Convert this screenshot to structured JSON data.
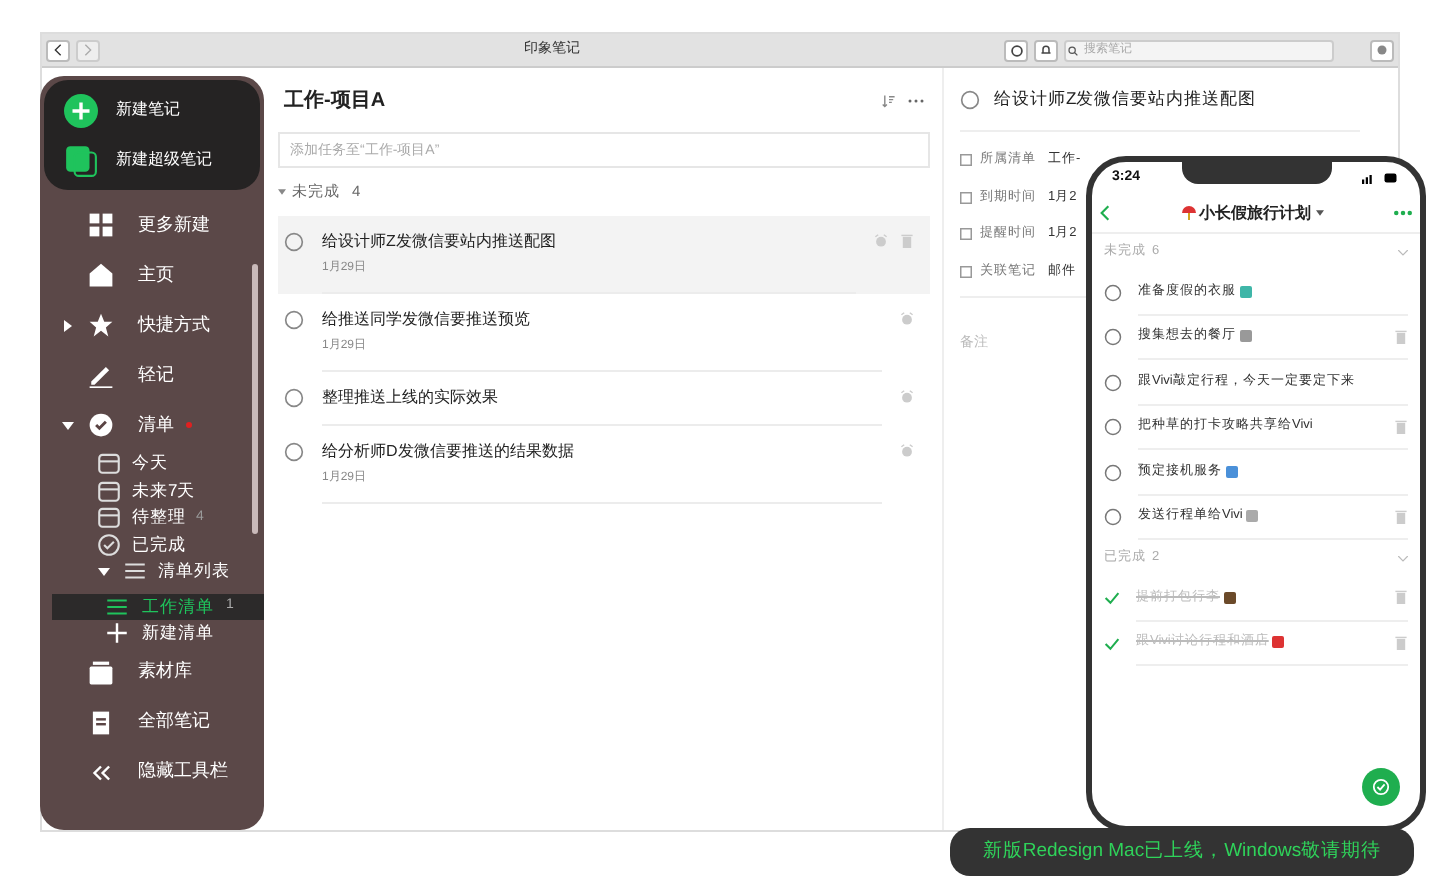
{
  "window": {
    "title": "印象笔记",
    "search": {
      "placeholder": "搜索笔记"
    }
  },
  "sidebar": {
    "top_actions": [
      {
        "label": "新建笔记",
        "kind": "note"
      },
      {
        "label": "新建超级笔记",
        "kind": "super"
      }
    ],
    "items": [
      {
        "label": "更多新建",
        "kind": "grid"
      },
      {
        "label": "主页",
        "kind": "home"
      },
      {
        "label": "快捷方式",
        "kind": "star",
        "expanded": false
      },
      {
        "label": "轻记",
        "kind": "pen"
      },
      {
        "label": "清单",
        "kind": "check",
        "expanded": true,
        "unread": true,
        "children": [
          {
            "label": "今天",
            "kind": "day"
          },
          {
            "label": "未来7天",
            "kind": "week"
          },
          {
            "label": "待整理",
            "kind": "inbox",
            "count": "4"
          },
          {
            "label": "已完成",
            "kind": "done"
          },
          {
            "label": "清单列表",
            "kind": "list",
            "expanded": true,
            "children": [
              {
                "label": "工作清单",
                "kind": "list",
                "count": "1",
                "selected": true
              },
              {
                "label": "新建清单",
                "kind": "plus",
                "selected": false
              }
            ]
          }
        ]
      },
      {
        "label": "素材库",
        "kind": "box"
      },
      {
        "label": "全部笔记",
        "kind": "notes"
      },
      {
        "label": "隐藏工具栏",
        "kind": "collapse"
      }
    ]
  },
  "list": {
    "title": "工作-项目A",
    "add_placeholder": "添加任务至“工作-项目A”",
    "section": "未完成",
    "count": "4",
    "tasks": [
      {
        "title": "给设计师Z发微信要站内推送配图",
        "date": "1月29日",
        "selected": true
      },
      {
        "title": "给推送同学发微信要推送预览",
        "date": "1月29日",
        "selected": false
      },
      {
        "title": "整理推送上线的实际效果",
        "selected": false
      },
      {
        "title": "给分析师D发微信要推送的结果数据",
        "date": "1月29日",
        "selected": false
      }
    ]
  },
  "detail": {
    "title": "给设计师Z发微信要站内推送配图",
    "fields": [
      {
        "label": "所属清单",
        "value": "工作-"
      },
      {
        "label": "到期时间",
        "value": "1月2"
      },
      {
        "label": "提醒时间",
        "value": "1月2"
      },
      {
        "label": "关联笔记",
        "value": "邮件"
      }
    ],
    "notes_placeholder": "备注"
  },
  "phone": {
    "time": "3:24",
    "title": "小长假旅行计划",
    "sections": [
      {
        "title": "未完成",
        "count": "6",
        "tasks": [
          {
            "title": "准备度假的衣服",
            "checked": false
          },
          {
            "title": "搜集想去的餐厅",
            "checked": false
          },
          {
            "title": "跟Vivi敲定行程，今天一定要定下来",
            "checked": false
          },
          {
            "title": "把种草的打卡攻略共享给Vivi",
            "checked": false
          },
          {
            "title": "预定接机服务",
            "checked": false
          },
          {
            "title": "发送行程单给Vivi",
            "checked": false
          }
        ]
      },
      {
        "title": "已完成",
        "count": "2",
        "tasks": [
          {
            "title": "提前打包行李",
            "checked": true
          },
          {
            "title": "跟Vivi讨论行程和酒店",
            "checked": true
          }
        ]
      }
    ]
  },
  "banner": "新版Redesign Mac已上线，Windows敬请期待"
}
